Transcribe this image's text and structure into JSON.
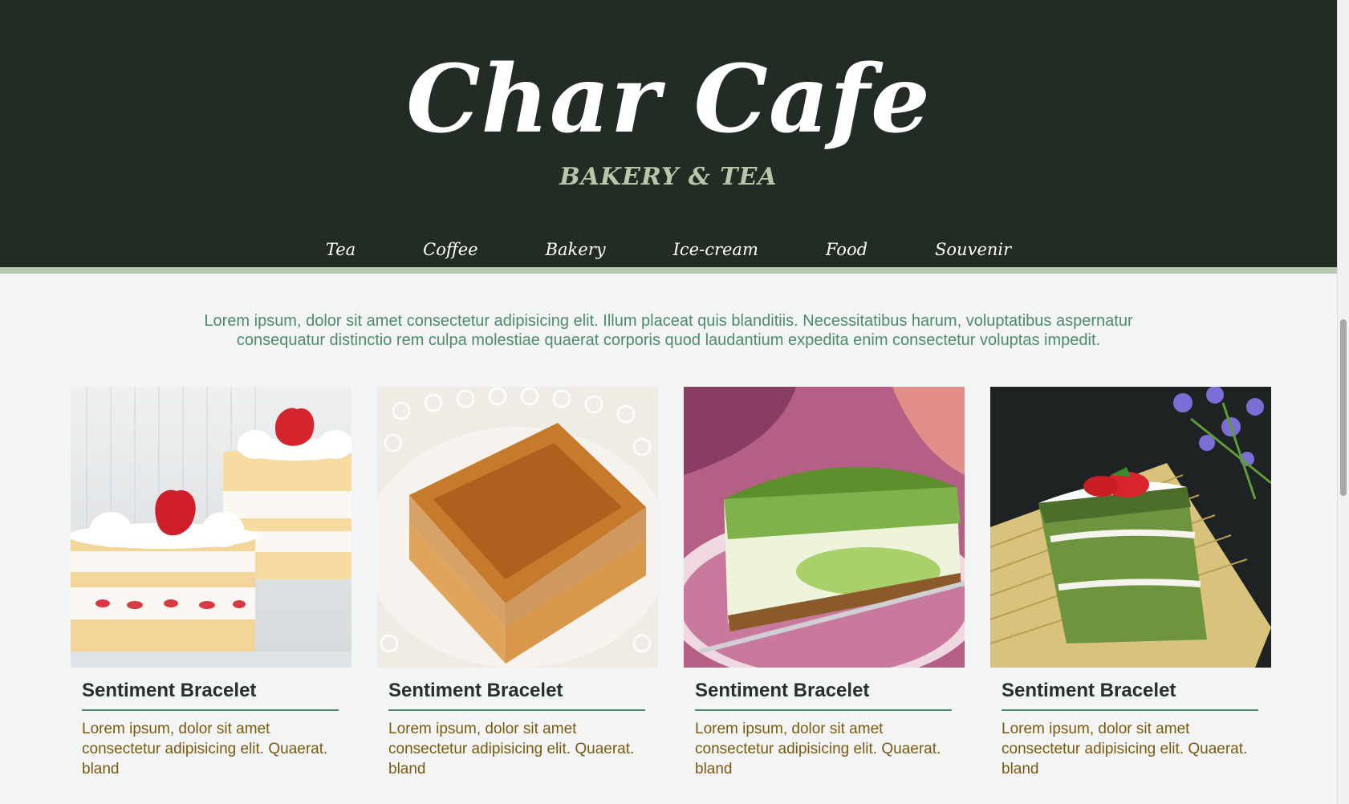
{
  "header": {
    "title": "Char Cafe",
    "tagline": "BAKERY & TEA",
    "nav": [
      "Tea",
      "Coffee",
      "Bakery",
      "Ice-cream",
      "Food",
      "Souvenir"
    ]
  },
  "intro": "Lorem ipsum, dolor sit amet consectetur adipisicing elit. Illum placeat quis blanditiis. Necessitatibus harum, voluptatibus aspernatur consequatur distinctio rem culpa molestiae quaerat corporis quod laudantium expedita enim consectetur voluptas impedit.",
  "cards": [
    {
      "image": "strawberry-shortcake-image",
      "title": "Sentiment Bracelet",
      "text": "Lorem ipsum, dolor sit amet consectetur adipisicing elit. Quaerat. bland"
    },
    {
      "image": "caramel-cake-image",
      "title": "Sentiment Bracelet",
      "text": "Lorem ipsum, dolor sit amet consectetur adipisicing elit. Quaerat. bland"
    },
    {
      "image": "matcha-cheesecake-image",
      "title": "Sentiment Bracelet",
      "text": "Lorem ipsum, dolor sit amet consectetur adipisicing elit. Quaerat. bland"
    },
    {
      "image": "matcha-layer-cake-image",
      "title": "Sentiment Bracelet",
      "text": "Lorem ipsum, dolor sit amet consectetur adipisicing elit. Quaerat. bland"
    }
  ],
  "colors": {
    "header_bg": "#222c25",
    "accent_green": "#4f8a6c",
    "stripe": "#b9c8b1",
    "body_text": "#7a5a12"
  }
}
